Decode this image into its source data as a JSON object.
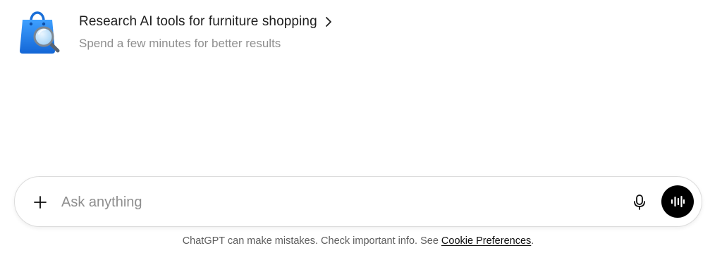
{
  "suggestion": {
    "icon": "shopping-bag-search-icon",
    "title": "Research AI tools for furniture shopping",
    "subtitle": "Spend a few minutes for better results"
  },
  "composer": {
    "placeholder": "Ask anything",
    "value": "",
    "plus_icon": "plus-icon",
    "mic_icon": "microphone-icon",
    "voice_icon": "voice-waveform-icon"
  },
  "disclaimer": {
    "text": "ChatGPT can make mistakes. Check important info. See",
    "link_text": "Cookie Preferences",
    "suffix": "."
  },
  "colors": {
    "bag_blue": "#1f7be6",
    "voice_button": "#000000",
    "placeholder": "#8e8e8e",
    "subtitle": "#8f8f8f"
  }
}
